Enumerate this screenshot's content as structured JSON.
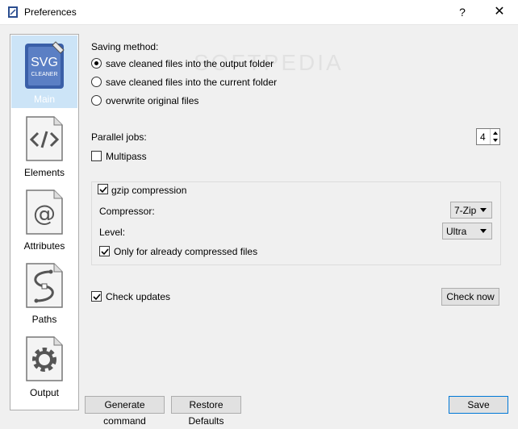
{
  "window": {
    "title": "Preferences",
    "help": "?",
    "close": "✕"
  },
  "sidebar": {
    "items": [
      {
        "label": "Main",
        "icon": "svg-cleaner-logo-icon",
        "logo_text": "SVG",
        "logo_sub": "CLEANER"
      },
      {
        "label": "Elements",
        "icon": "code-tag-icon"
      },
      {
        "label": "Attributes",
        "icon": "at-sign-icon"
      },
      {
        "label": "Paths",
        "icon": "bezier-path-icon"
      },
      {
        "label": "Output",
        "icon": "gear-icon"
      }
    ]
  },
  "saving": {
    "heading": "Saving method:",
    "options": [
      {
        "label": "save cleaned files into the output folder",
        "selected": true
      },
      {
        "label": "save cleaned files into the current folder",
        "selected": false
      },
      {
        "label": "overwrite original files",
        "selected": false
      }
    ]
  },
  "parallel": {
    "label": "Parallel jobs:",
    "value": "4"
  },
  "multipass": {
    "label": "Multipass",
    "checked": false
  },
  "gzip": {
    "label": "gzip compression",
    "checked": true,
    "compressor_label": "Compressor:",
    "compressor_value": "7-Zip",
    "level_label": "Level:",
    "level_value": "Ultra",
    "only_compressed_label": "Only for already compressed files",
    "only_compressed_checked": true
  },
  "updates": {
    "label": "Check updates",
    "checked": true,
    "check_now": "Check now"
  },
  "footer": {
    "generate": "Generate command",
    "restore": "Restore Defaults",
    "save": "Save"
  },
  "watermark": "SOFTPEDIA",
  "colors": {
    "selection": "#cce4f7",
    "default_button_border": "#0078d7"
  }
}
